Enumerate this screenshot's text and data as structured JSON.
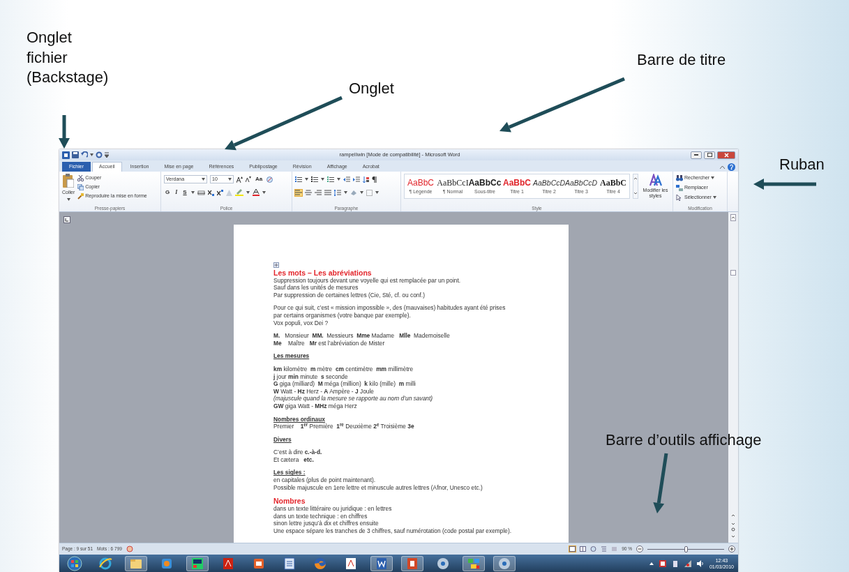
{
  "annotations": [
    {
      "kind": "file",
      "text": "Onglet fichier (Backstage)"
    },
    {
      "kind": "tab",
      "text": "Onglet"
    },
    {
      "kind": "title",
      "text": "Barre de titre"
    },
    {
      "kind": "ribbon",
      "text": "Ruban"
    },
    {
      "kind": "status",
      "text": "Barre d’outils affichage"
    }
  ],
  "window": {
    "title": "rampeIIwin [Mode de compatibilité] - Microsoft Word"
  },
  "tabs": [
    {
      "label": "Fichier",
      "kind": "file",
      "selected": false
    },
    {
      "label": "Accueil",
      "kind": "tab",
      "selected": true
    },
    {
      "label": "Insertion",
      "kind": "tab",
      "selected": false
    },
    {
      "label": "Mise en page",
      "kind": "tab",
      "selected": false
    },
    {
      "label": "Références",
      "kind": "tab",
      "selected": false
    },
    {
      "label": "Publipostage",
      "kind": "tab",
      "selected": false
    },
    {
      "label": "Révision",
      "kind": "tab",
      "selected": false
    },
    {
      "label": "Affichage",
      "kind": "tab",
      "selected": false
    },
    {
      "label": "Acrobat",
      "kind": "tab",
      "selected": false
    }
  ],
  "ribbon": {
    "clipboard": {
      "label": "Presse-papiers",
      "paste": "Coller",
      "cut": "Couper",
      "copy": "Copier",
      "format_painter": "Reproduire la mise en forme"
    },
    "font": {
      "label": "Police",
      "font_name": "Verdana",
      "font_size": "10",
      "case_button": "Aa",
      "bold": "G",
      "italic": "I",
      "underline": "S"
    },
    "paragraph": {
      "label": "Paragraphe"
    },
    "styles": {
      "label": "Style",
      "change_styles": "Modifier les styles",
      "items": [
        {
          "sample": "AaBbC",
          "label": "¶ Légende",
          "kind": "sans",
          "color": "#e0252b"
        },
        {
          "sample": "AaBbCcI",
          "label": "¶ Normal",
          "kind": "serif",
          "color": "#222222"
        },
        {
          "sample": "AaBbCc",
          "label": "Sous-titre",
          "kind": "bold",
          "color": "#222222"
        },
        {
          "sample": "AaBbC",
          "label": "Titre 1",
          "kind": "bold",
          "color": "#e0252b"
        },
        {
          "sample": "AaBbCcD",
          "label": "Titre 2",
          "kind": "italic",
          "color": "#333333"
        },
        {
          "sample": "AaBbCcD",
          "label": "Titre 3",
          "kind": "italic",
          "color": "#333333"
        },
        {
          "sample": "AaBbC",
          "label": "Titre 4",
          "kind": "bold-serif",
          "color": "#222222"
        }
      ]
    },
    "editing": {
      "label": "Modification",
      "items": [
        {
          "label": "Rechercher",
          "dropdown": true
        },
        {
          "label": "Remplacer",
          "dropdown": false
        },
        {
          "label": "Sélectionner",
          "dropdown": true
        }
      ]
    }
  },
  "document": {
    "blocks": [
      {
        "heading": "Les mots – Les abréviations",
        "kind": "title",
        "lines": [
          "Suppression toujours devant une voyelle qui est remplacée par un point.",
          "Sauf dans les unités de mesures",
          "Par suppression de certaines lettres (Cie, Sté, cf. ou conf.)"
        ]
      },
      {
        "lines": [
          "Pour ce qui suit, c’est « mission impossible », des (mauvaises) habitudes ayant été prises",
          "par certains organismes (votre banque par exemple).",
          "Vox populi, vox Dei ?"
        ]
      },
      {
        "lines": [
          "**M.**   Monsieur  **MM.**  Messieurs  **Mme** Madame   **Mlle**  Mademoiselle",
          "**Me**    Maître   **Mr** est l’abréviation de Mister"
        ]
      },
      {
        "heading": "Les mesures",
        "kind": "section"
      },
      {
        "lines": [
          "**km** kilomètre  **m** mètre  **cm** centimètre  **mm** millimètre",
          "**j** jour **min** minute  **s** seconde",
          "**G** giga (milliard)  **M** méga (million)  **k** kilo (mille)  **m** milli",
          "**W** Watt - **Hz** Herz - **A** Ampère - **J** Joule",
          {
            "text": "(majuscule quand la mesure se rapporte au nom d’un savant)",
            "italic": true
          },
          "**GW** giga Watt - **MHz** méga Herz"
        ]
      },
      {
        "heading": "Nombres ordinaux",
        "kind": "section",
        "lines": [
          "Premier    **1$^{er}$** Première  **1$^{re}$** Deuxième **2$^{e}$** Troisième **3e**"
        ]
      },
      {
        "heading": "Divers",
        "kind": "section"
      },
      {
        "lines": [
          "C’est à dire **c.-à-d.**",
          "Et cætera   **etc.**"
        ]
      },
      {
        "heading": "Les sigles :",
        "kind": "section",
        "lines": [
          "en capitales (plus de point maintenant).",
          "Possible majuscule en 1ere lettre et minuscule autres lettres (Afnor, Unesco etc.)"
        ]
      },
      {
        "heading": "Nombres",
        "kind": "title",
        "lines": [
          "dans un texte littéraire ou juridique : en lettres",
          "dans un texte technique : en chiffres",
          "sinon lettre jusqu’à dix et chiffres ensuite",
          "Une espace sépare les tranches de 3 chiffres, sauf numérotation (code postal par exemple)."
        ]
      }
    ]
  },
  "status_bar": {
    "page": "Page : 9 sur 51",
    "words": "Mots : 6 799",
    "zoom": "90 %",
    "zoom_slider": {
      "level": 0.5
    }
  },
  "taskbar": {
    "time": "12:43",
    "date": "01/03/2010"
  }
}
